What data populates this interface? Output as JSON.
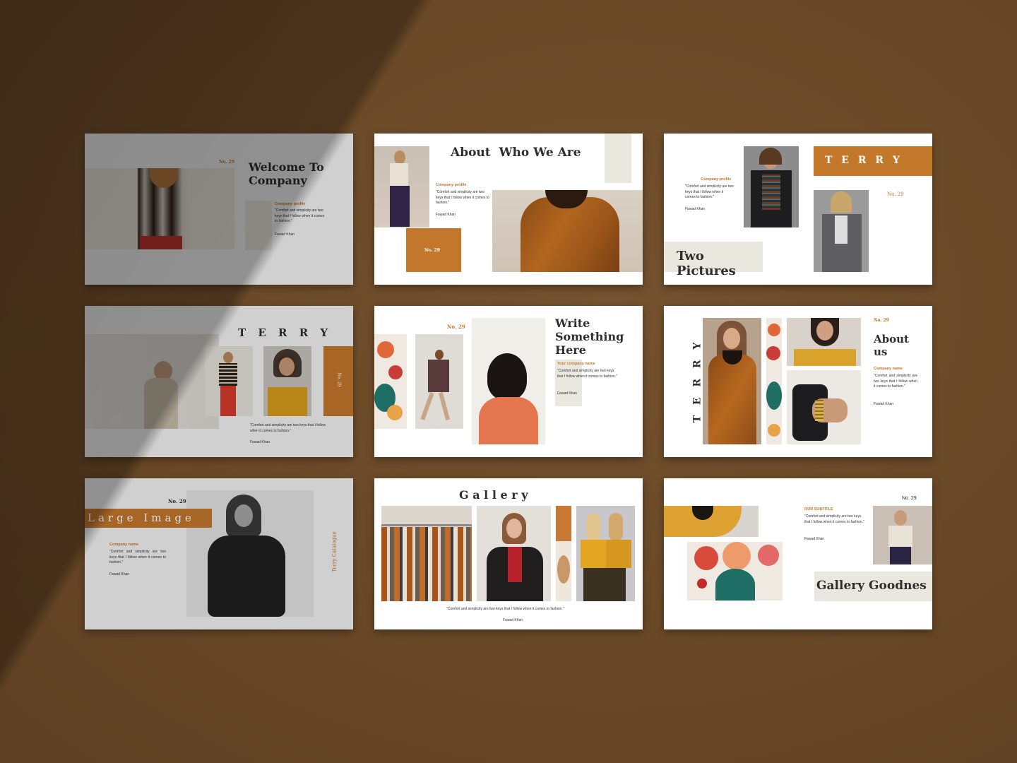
{
  "colors": {
    "accent": "#c2772b",
    "beige": "#eae8de",
    "wall": "#6b4a29"
  },
  "quote": "\"Comfort and simplicity are two keys that I follow when it comes to fashion.\"",
  "author": "Fawad Khan",
  "slides": {
    "s1": {
      "number": "No. 29",
      "title": "Welcome To Company",
      "label": "Company profile"
    },
    "s2": {
      "title": "About  Who We Are",
      "label": "Company profile",
      "number": "No. 29"
    },
    "s3": {
      "label": "Company profile",
      "brand": "T E R R Y",
      "number": "No. 29",
      "title": "Two Pictures"
    },
    "s4": {
      "brand": "T E R R Y",
      "number": "No. 29"
    },
    "s5": {
      "number": "No. 29",
      "title": "Write Something Here",
      "label": "Your company name"
    },
    "s6": {
      "brand": "T E R R Y",
      "number": "No. 29",
      "title": "About us",
      "label": "Company name"
    },
    "s7": {
      "number": "No. 29",
      "title": "Large Image",
      "label": "Company name",
      "side": "Terry Catalogue"
    },
    "s8": {
      "title": "G a l l e r y"
    },
    "s9": {
      "number": "No. 29",
      "label": "OUR SUBTITLE",
      "title": "Gallery Goodnes"
    }
  }
}
